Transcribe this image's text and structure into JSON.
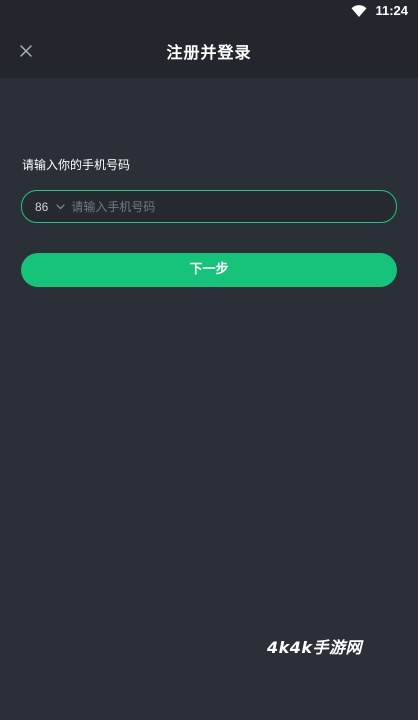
{
  "status_bar": {
    "time": "11:24",
    "wifi_icon": "wifi-icon"
  },
  "header": {
    "title": "注册并登录",
    "close_icon": "close-icon"
  },
  "form": {
    "prompt": "请输入你的手机号码",
    "country_code": "86",
    "country_chevron_icon": "chevron-down-icon",
    "phone_value": "",
    "phone_placeholder": "请输入手机号码",
    "next_label": "下一步"
  },
  "watermark": {
    "text": "4k4k手游网"
  },
  "colors": {
    "background": "#2b3038",
    "header_background": "#23272d",
    "accent": "#17c37a",
    "field_border": "#1fc77a"
  }
}
